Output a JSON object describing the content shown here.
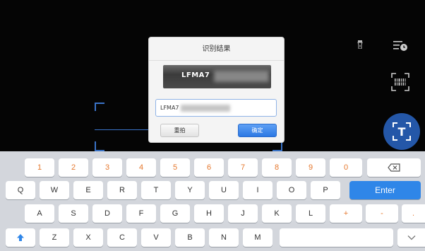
{
  "camera": {
    "icons": {
      "torch": "torch-icon",
      "history": "history-list-icon",
      "barcode": "barcode-scan-icon",
      "text_ocr": "text-recognition-icon"
    },
    "ocr_button_label": "T"
  },
  "dialog": {
    "title": "识别结果",
    "preview_text": "LFMA7",
    "input_value": "LFMA7",
    "retake_label": "重拍",
    "confirm_label": "确定"
  },
  "keyboard": {
    "number_row": [
      "1",
      "2",
      "3",
      "4",
      "5",
      "6",
      "7",
      "8",
      "9",
      "0"
    ],
    "row1": [
      "Q",
      "W",
      "E",
      "R",
      "T",
      "Y",
      "U",
      "I",
      "O",
      "P"
    ],
    "row2": [
      "A",
      "S",
      "D",
      "F",
      "G",
      "H",
      "J",
      "K",
      "L"
    ],
    "row2_extra": [
      "+",
      "-",
      "."
    ],
    "row3": [
      "Z",
      "X",
      "C",
      "V",
      "B",
      "N",
      "M"
    ],
    "enter_label": "Enter",
    "backspace_icon": "backspace-icon",
    "shift_icon": "shift-arrow-icon",
    "hide_icon": "chevron-down-icon"
  },
  "colors": {
    "accent": "#2f86e8",
    "number_key_text": "#e5782e",
    "ocr_button": "#2457a8"
  }
}
